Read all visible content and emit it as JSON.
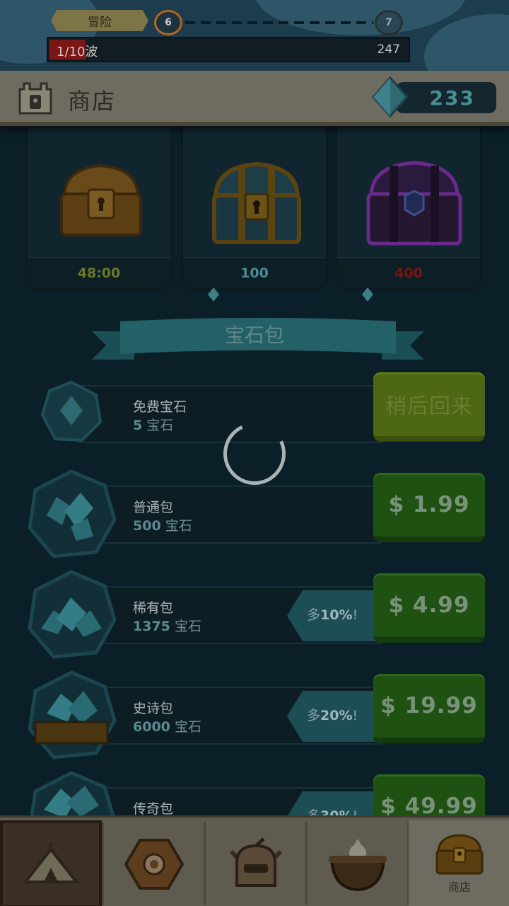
{
  "progress": {
    "adventure_label": "冒险",
    "current_level": "6",
    "next_level": "7",
    "wave_label": "1/10波",
    "wave_fraction": 0.1,
    "wave_value": "247"
  },
  "header": {
    "title": "商店",
    "gem_balance": "233"
  },
  "chests": [
    {
      "price": "48:00",
      "price_color": "#6c7a2a",
      "has_gem": false
    },
    {
      "price": "100",
      "price_color": "#4d8a92",
      "has_gem": true
    },
    {
      "price": "400",
      "price_color": "#7a1414",
      "has_gem": true
    }
  ],
  "section": {
    "title": "宝石包"
  },
  "packs": [
    {
      "name": "免费宝石",
      "qty": "5",
      "unit": "宝石",
      "bonus": "",
      "button": "稍后回来"
    },
    {
      "name": "普通包",
      "qty": "500",
      "unit": "宝石",
      "bonus": "",
      "button": "$ 1.99"
    },
    {
      "name": "稀有包",
      "qty": "1375",
      "unit": "宝石",
      "bonus_prefix": "多",
      "bonus": "10%",
      "bonus_suffix": "!",
      "button": "$ 4.99"
    },
    {
      "name": "史诗包",
      "qty": "6000",
      "unit": "宝石",
      "bonus_prefix": "多",
      "bonus": "20%",
      "bonus_suffix": "!",
      "button": "$ 19.99"
    },
    {
      "name": "传奇包",
      "qty": "",
      "unit": "",
      "bonus_prefix": "多",
      "bonus": "30%",
      "bonus_suffix": "!",
      "button": "$ 49.99"
    }
  ],
  "nav": {
    "shop_label": "商店"
  },
  "colors": {
    "accent_gem": "#3f7f88",
    "button_green": "#1f5212"
  }
}
